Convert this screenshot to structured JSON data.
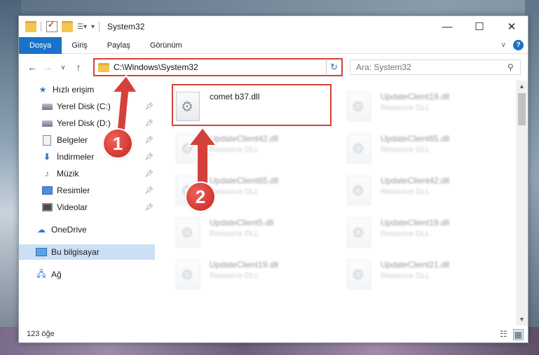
{
  "window": {
    "title": "System32",
    "controls": {
      "minimize": "—",
      "maximize": "☐",
      "close": "✕"
    }
  },
  "ribbon": {
    "tabs": [
      "Dosya",
      "Giriş",
      "Paylaş",
      "Görünüm"
    ],
    "help": "?"
  },
  "address": {
    "path": "C:\\Windows\\System32",
    "search_placeholder": "Ara: System32"
  },
  "nav": {
    "quick_access": "Hızlı erişim",
    "items": [
      {
        "label": "Yerel Disk (C:)",
        "icon": "drive-icon",
        "pinned": true
      },
      {
        "label": "Yerel Disk (D:)",
        "icon": "drive-icon",
        "pinned": true
      },
      {
        "label": "Belgeler",
        "icon": "documents-icon",
        "pinned": true
      },
      {
        "label": "İndirmeler",
        "icon": "downloads-icon",
        "pinned": true
      },
      {
        "label": "Müzik",
        "icon": "music-icon",
        "pinned": true
      },
      {
        "label": "Resimler",
        "icon": "pictures-icon",
        "pinned": true
      },
      {
        "label": "Videolar",
        "icon": "videos-icon",
        "pinned": true
      }
    ],
    "onedrive": "OneDrive",
    "this_pc": "Bu bilgisayar",
    "network": "Ağ"
  },
  "files": [
    {
      "name": "comet b37.dll",
      "type": ""
    },
    {
      "name": "UpdateClient19.dll",
      "type": "Resource DLL"
    },
    {
      "name": "UpdateClient42.dll",
      "type": "Resource DLL"
    },
    {
      "name": "UpdateClient65.dll",
      "type": "Resource DLL"
    },
    {
      "name": "UpdateClient65.dll",
      "type": "Resource DLL"
    },
    {
      "name": "UpdateClient42.dll",
      "type": "Resource DLL"
    },
    {
      "name": "UpdateClient5.dll",
      "type": "Resource DLL"
    },
    {
      "name": "UpdateClient19.dll",
      "type": "Resource DLL"
    },
    {
      "name": "UpdateClient19.dll",
      "type": "Resource DLL"
    },
    {
      "name": "UpdateClient21.dll",
      "type": "Resource DLL"
    }
  ],
  "status": {
    "item_count": "123 öğe"
  },
  "annotations": {
    "step1": "1",
    "step2": "2",
    "color": "#d4413a"
  }
}
